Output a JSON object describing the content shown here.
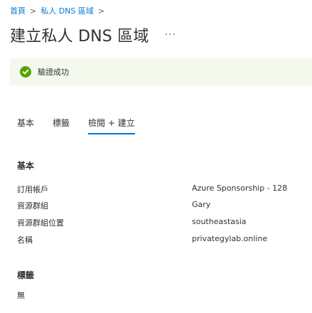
{
  "breadcrumb": {
    "items": [
      "首頁",
      "私人 DNS 區域"
    ],
    "separator": ">"
  },
  "page": {
    "title": "建立私人 DNS 區域",
    "more_label": "···"
  },
  "validation": {
    "text": "驗證成功",
    "icon": "checkmark-circle-icon",
    "color": "#57a300",
    "background": "#f3f9ed"
  },
  "tabs": [
    {
      "label": "基本",
      "active": false
    },
    {
      "label": "標籤",
      "active": false
    },
    {
      "label": "檢閱 + 建立",
      "active": true
    }
  ],
  "accent_color": "#0078d4",
  "summary": {
    "basics": {
      "heading": "基本",
      "rows": [
        {
          "label": "訂用帳戶",
          "value": "Azure Sponsorship - 128"
        },
        {
          "label": "資源群組",
          "value": "Gary"
        },
        {
          "label": "資源群組位置",
          "value": "southeastasia"
        },
        {
          "label": "名稱",
          "value": "privategylab.online"
        }
      ]
    },
    "tags": {
      "heading": "標籤",
      "empty_text": "無"
    }
  }
}
